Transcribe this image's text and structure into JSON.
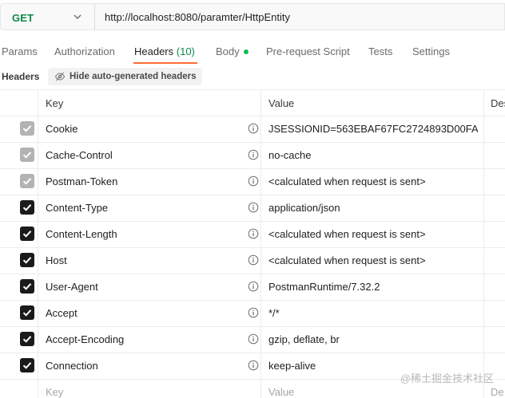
{
  "request": {
    "method": "GET",
    "url": "http://localhost:8080/paramter/HttpEntity"
  },
  "tabs": [
    {
      "label": "Params"
    },
    {
      "label": "Authorization"
    },
    {
      "label": "Headers",
      "count": "(10)",
      "active": true
    },
    {
      "label": "Body"
    },
    {
      "label": "Pre-request Script"
    },
    {
      "label": "Tests"
    },
    {
      "label": "Settings"
    }
  ],
  "headers_section": {
    "title": "Headers",
    "hide_button": "Hide auto-generated headers"
  },
  "table": {
    "columns": {
      "key": "Key",
      "value": "Value",
      "description": "Des"
    },
    "rows": [
      {
        "key": "Cookie",
        "value": "JSESSIONID=563EBAF67FC2724893D00FA...",
        "checked": true,
        "auto": true
      },
      {
        "key": "Cache-Control",
        "value": "no-cache",
        "checked": true,
        "auto": true
      },
      {
        "key": "Postman-Token",
        "value": "<calculated when request is sent>",
        "checked": true,
        "auto": true
      },
      {
        "key": "Content-Type",
        "value": "application/json",
        "checked": true,
        "auto": false
      },
      {
        "key": "Content-Length",
        "value": "<calculated when request is sent>",
        "checked": true,
        "auto": false
      },
      {
        "key": "Host",
        "value": "<calculated when request is sent>",
        "checked": true,
        "auto": false
      },
      {
        "key": "User-Agent",
        "value": "PostmanRuntime/7.32.2",
        "checked": true,
        "auto": false
      },
      {
        "key": "Accept",
        "value": "*/*",
        "checked": true,
        "auto": false
      },
      {
        "key": "Accept-Encoding",
        "value": "gzip, deflate, br",
        "checked": true,
        "auto": false
      },
      {
        "key": "Connection",
        "value": "keep-alive",
        "checked": true,
        "auto": false
      }
    ],
    "new_row": {
      "key_placeholder": "Key",
      "value_placeholder": "Value",
      "description_placeholder": "De"
    }
  },
  "watermark": "@稀土掘金技术社区",
  "colors": {
    "method": "#0b8a4c",
    "active_tab_underline": "#ff6c37",
    "body_dot": "#0cbb52",
    "checkbox_enabled": "#1a1a1a",
    "checkbox_disabled": "#b3b3b3"
  },
  "icons": {
    "method_dropdown": "chevron-down-icon",
    "hide_button": "eye-off-icon",
    "row_info": "info-icon",
    "checkbox": "check-icon"
  }
}
